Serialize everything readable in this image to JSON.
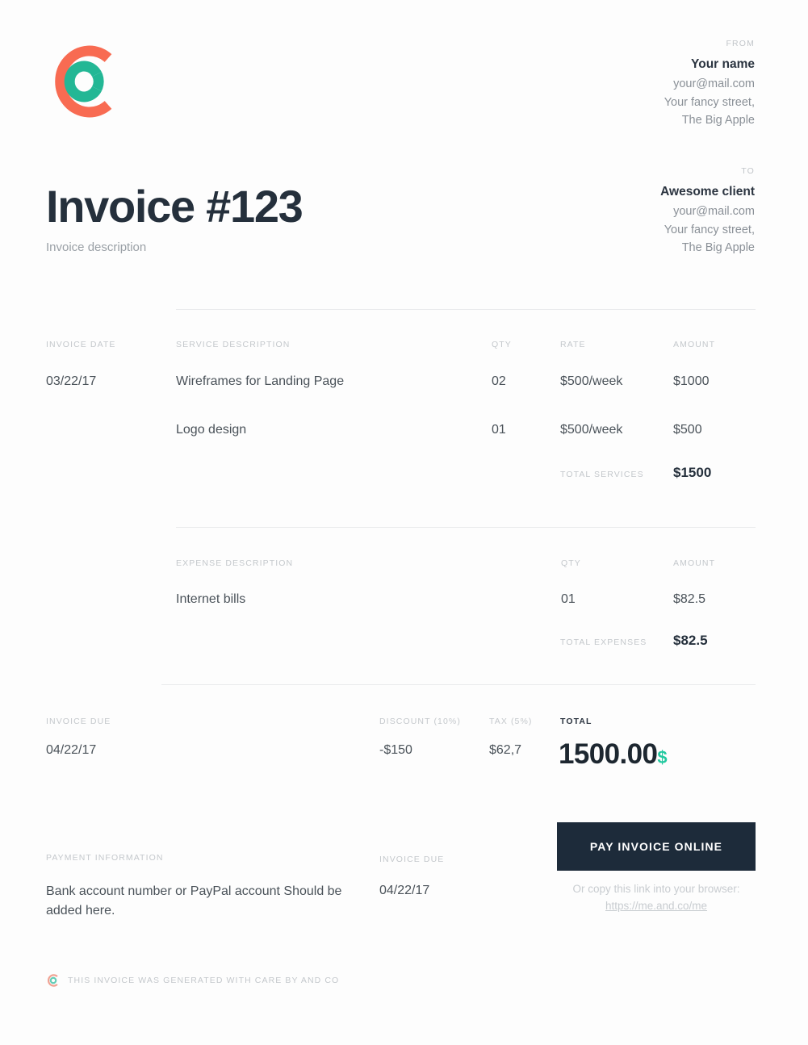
{
  "brand": {
    "logo_icon": "and-co-circle-logo",
    "outer_ring_color": "#f86b52",
    "inner_ring_color": "#23b795",
    "accent_color": "#23c9a0",
    "dark_color": "#1d2b3a"
  },
  "from": {
    "kicker": "FROM",
    "name": "Your name",
    "email": "your@mail.com",
    "street": "Your fancy street,",
    "city": "The Big Apple"
  },
  "to": {
    "kicker": "TO",
    "name": "Awesome client",
    "email": "your@mail.com",
    "street": "Your fancy street,",
    "city": "The Big Apple"
  },
  "header": {
    "title": "Invoice #123",
    "subtitle": "Invoice description"
  },
  "services": {
    "labels": {
      "invoice_date": "INVOICE DATE",
      "description": "SERVICE DESCRIPTION",
      "qty": "QTY",
      "rate": "RATE",
      "amount": "AMOUNT"
    },
    "invoice_date": "03/22/17",
    "rows": [
      {
        "description": "Wireframes for Landing Page",
        "qty": "02",
        "rate": "$500/week",
        "amount": "$1000"
      },
      {
        "description": "Logo design",
        "qty": "01",
        "rate": "$500/week",
        "amount": "$500"
      }
    ],
    "total_label": "TOTAL SERVICES",
    "total_value": "$1500"
  },
  "expenses": {
    "labels": {
      "description": "EXPENSE DESCRIPTION",
      "qty": "QTY",
      "amount": "AMOUNT"
    },
    "rows": [
      {
        "description": "Internet bills",
        "qty": "01",
        "amount": "$82.5"
      }
    ],
    "total_label": "TOTAL EXPENSES",
    "total_value": "$82.5"
  },
  "summary": {
    "invoice_due_label": "INVOICE DUE",
    "invoice_due_value": "04/22/17",
    "discount_label": "DISCOUNT (10%)",
    "discount_value": "-$150",
    "tax_label": "TAX (5%)",
    "tax_value": "$62,7",
    "total_label": "TOTAL",
    "total_amount": "1500.00",
    "total_currency": "$"
  },
  "payment": {
    "button_label": "PAY INVOICE ONLINE",
    "note_prefix": "Or copy this link into your browser: ",
    "note_link": "https://me.and.co/me",
    "info_label": "PAYMENT INFORMATION",
    "info_text": "Bank account number or PayPal account Should be added here.",
    "due_label": "INVOICE DUE",
    "due_value": "04/22/17"
  },
  "footer": {
    "logo_icon": "and-co-circle-logo-small",
    "text": "THIS INVOICE WAS GENERATED WITH CARE BY AND CO"
  }
}
